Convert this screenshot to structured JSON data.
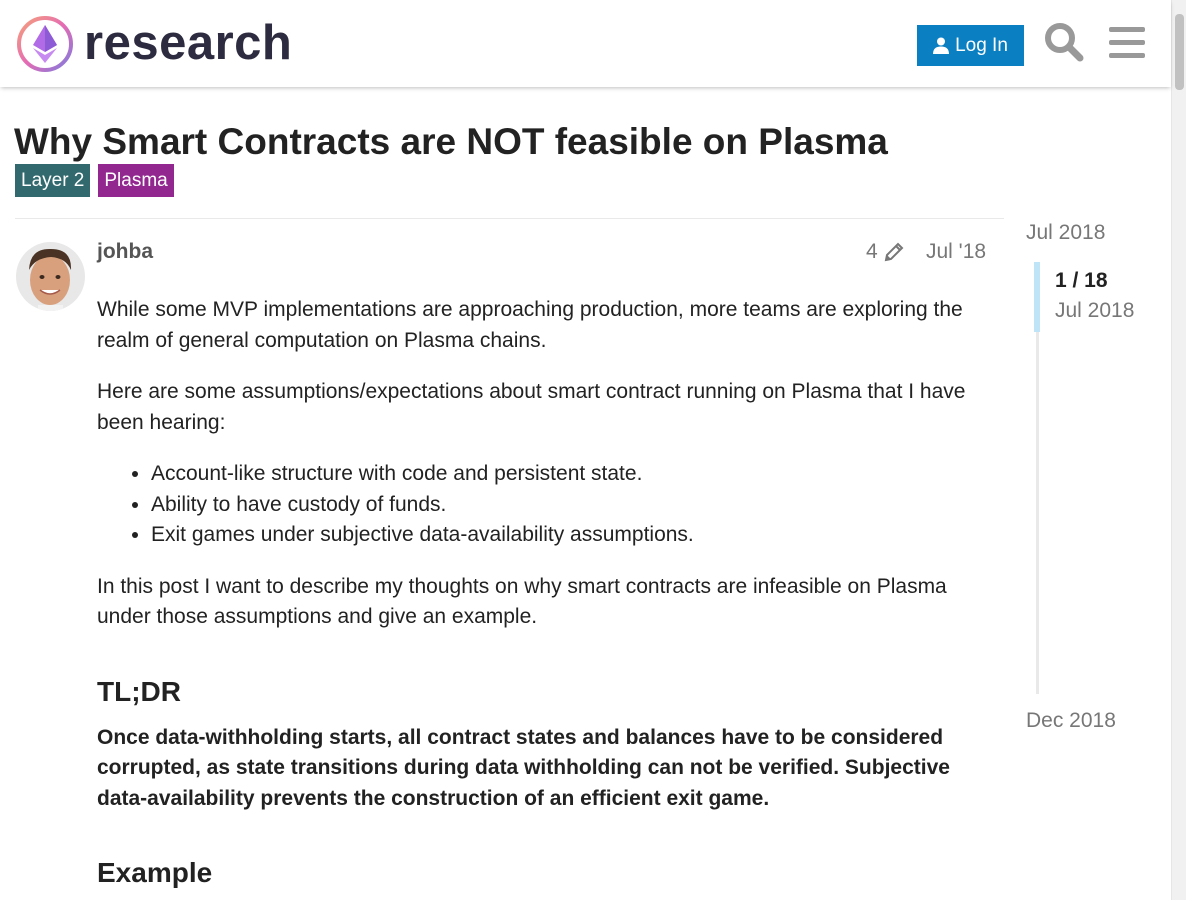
{
  "header": {
    "logo_text": "research",
    "login_label": "Log In",
    "icons": [
      "ethereum-logo-icon",
      "user-icon",
      "search-icon",
      "menu-icon"
    ]
  },
  "topic": {
    "title": "Why Smart Contracts are NOT feasible on Plasma",
    "tags": [
      {
        "label": "Layer 2",
        "color": "#31696e"
      },
      {
        "label": "Plasma",
        "color": "#92278f"
      }
    ]
  },
  "post": {
    "username": "johba",
    "edit_count": "4",
    "date": "Jul '18",
    "paragraphs": [
      "While some MVP implementations are approaching production, more teams are exploring the realm of general computation on Plasma chains.",
      "Here are some assumptions/expectations about smart contract running on Plasma that I have been hearing:"
    ],
    "bullets": [
      "Account-like structure with code and persistent state.",
      "Ability to have custody of funds.",
      "Exit games under subjective data-availability assumptions."
    ],
    "paragraph_after": "In this post I want to describe my thoughts on why smart contracts are infeasible on Plasma under those assumptions and give an example.",
    "tldr_heading": "TL;DR",
    "tldr_text": "Once data-withholding starts, all contract states and balances have to be considered corrupted, as state transitions during data withholding can not be verified. Subjective data-availability prevents the construction of an efficient exit game.",
    "example_heading": "Example"
  },
  "timeline": {
    "start_date": "Jul 2018",
    "position": "1 / 18",
    "position_date": "Jul 2018",
    "end_date": "Dec 2018"
  },
  "colors": {
    "accent": "#0a7fc2",
    "title_text": "#222222",
    "muted_text": "#777777",
    "timeline_handle": "#bfe3f7"
  }
}
